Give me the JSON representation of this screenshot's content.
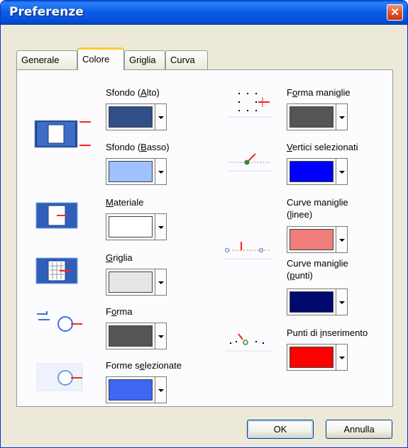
{
  "window": {
    "title": "Preferenze",
    "close_glyph": "✕"
  },
  "tabs": [
    {
      "label": "Generale",
      "active": false
    },
    {
      "label": "Colore",
      "active": true
    },
    {
      "label": "Griglia",
      "active": false
    },
    {
      "label": "Curva",
      "active": false
    }
  ],
  "left_column": [
    {
      "label_parts": [
        "Sfondo (",
        "A",
        "lto)"
      ],
      "color": "#2f4f86",
      "icon": "background-top-icon"
    },
    {
      "label_parts": [
        "Sfondo (",
        "B",
        "asso)"
      ],
      "color": "#9ec1ff",
      "icon": "background-bottom-icon"
    },
    {
      "label_parts": [
        "",
        "M",
        "ateriale"
      ],
      "color": "#ffffff",
      "icon": "material-icon"
    },
    {
      "label_parts": [
        "",
        "G",
        "riglia"
      ],
      "color": "#e6e6e6",
      "icon": "grid-icon"
    },
    {
      "label_parts": [
        "F",
        "o",
        "rma"
      ],
      "color": "#555555",
      "icon": "shape-icon"
    },
    {
      "label_parts": [
        "Forme s",
        "e",
        "lezionate"
      ],
      "color": "#3d66f2",
      "icon": "selected-shapes-icon"
    }
  ],
  "right_column": [
    {
      "label_parts": [
        "F",
        "o",
        "rma maniglie"
      ],
      "color": "#555555",
      "icon": "handle-shape-icon"
    },
    {
      "label_parts": [
        "",
        "V",
        "ertici selezionati"
      ],
      "color": "#0000ff",
      "icon": "selected-vertices-icon"
    },
    {
      "label_parts": [
        "Curve maniglie",
        "",
        ""
      ],
      "label_line2_parts": [
        "(",
        "l",
        "inee)"
      ],
      "color": "#f07c7c",
      "icon": "curve-handle-lines-icon"
    },
    {
      "label_parts": [
        "Curve maniglie",
        "",
        ""
      ],
      "label_line2_parts": [
        "(",
        "p",
        "unti)"
      ],
      "color": "#000a6e",
      "icon": "curve-handle-points-icon"
    },
    {
      "label_parts": [
        "Punti di ",
        "i",
        "nserimento"
      ],
      "color": "#ff0000",
      "icon": "insertion-points-icon"
    }
  ],
  "buttons": {
    "ok": "OK",
    "cancel": "Annulla"
  },
  "colors": {
    "titlebar": "#0a5ee8",
    "dialog_bg": "#ece9d8",
    "panel_bg": "#fcfcfe",
    "tab_accent": "#ffc83c"
  }
}
